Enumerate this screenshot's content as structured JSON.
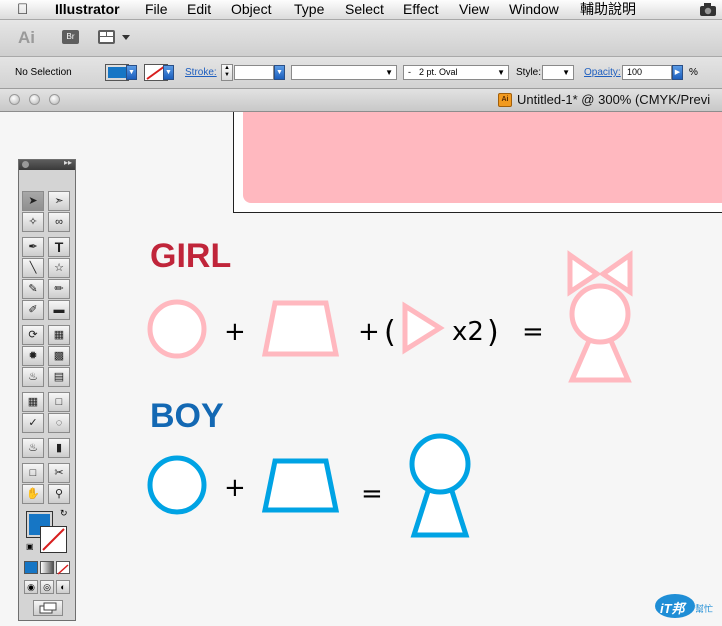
{
  "menubar": {
    "app_name": "Illustrator",
    "items": [
      "File",
      "Edit",
      "Object",
      "Type",
      "Select",
      "Effect",
      "View",
      "Window",
      "輔助說明"
    ]
  },
  "appbar": {
    "ai_logo": "Ai",
    "bridge_label": "Br"
  },
  "control": {
    "selection_label": "No Selection",
    "stroke_label": "Stroke:",
    "brush_value": "2 pt. Oval",
    "style_label": "Style:",
    "opacity_label": "Opacity:",
    "opacity_value": "100",
    "percent": "%",
    "fill_color": "#1676c5",
    "stroke_none_color": "#d81e1e"
  },
  "document": {
    "title": "Untitled-1* @ 300% (CMYK/Previ",
    "icon_label": "Ai"
  },
  "artwork": {
    "girl_label": "GIRL",
    "boy_label": "BOY",
    "plus": "+",
    "equals": "=",
    "paren_open": "(",
    "paren_close": ")",
    "times_two": "x2",
    "girl_color": "#c0253a",
    "boy_color": "#1368b3",
    "pink": "#ffb8bf",
    "cyan": "#00a3e4"
  },
  "tools": {
    "type_tool": "T",
    "fill_color": "#1676c5"
  },
  "watermark": {
    "text": "iT邦",
    "sub": "幫忙"
  }
}
